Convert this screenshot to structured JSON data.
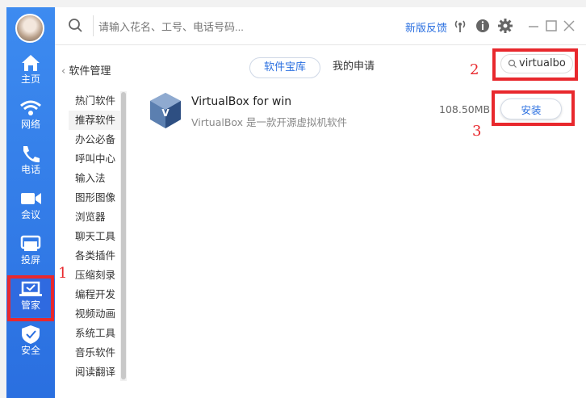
{
  "sidebar": {
    "items": [
      {
        "id": "home",
        "label": "主页"
      },
      {
        "id": "network",
        "label": "网络"
      },
      {
        "id": "phone",
        "label": "电话"
      },
      {
        "id": "meeting",
        "label": "会议"
      },
      {
        "id": "screen",
        "label": "投屏"
      },
      {
        "id": "manager",
        "label": "管家"
      },
      {
        "id": "security",
        "label": "安全"
      }
    ]
  },
  "header": {
    "search_placeholder": "请输入花名、工号、电话号码...",
    "feedback_label": "新版反馈"
  },
  "subheader": {
    "back_label": "软件管理",
    "tabs": [
      {
        "label": "软件宝库"
      },
      {
        "label": "我的申请"
      }
    ],
    "search_value": "virtualbo"
  },
  "categories": [
    "热门软件",
    "推荐软件",
    "办公必备",
    "呼叫中心",
    "输入法",
    "图形图像",
    "浏览器",
    "聊天工具",
    "各类插件",
    "压缩刻录",
    "编程开发",
    "视频动画",
    "系统工具",
    "音乐软件",
    "阅读翻译"
  ],
  "app": {
    "name": "VirtualBox for win",
    "description": "VirtualBox 是一款开源虚拟机软件",
    "size": "108.50MB",
    "install_label": "安装"
  },
  "annotations": [
    "1",
    "2",
    "3"
  ],
  "colors": {
    "accent": "#2a6fe0",
    "highlight": "#e8282d"
  }
}
